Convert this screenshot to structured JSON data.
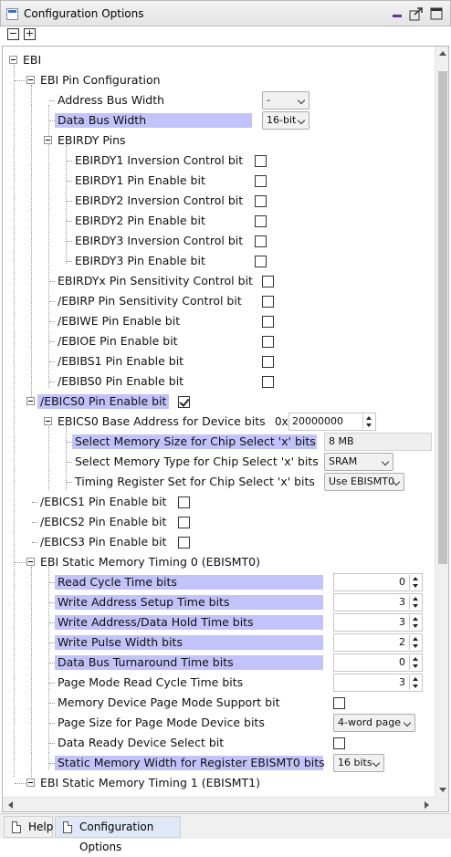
{
  "window": {
    "title": "Configuration Options",
    "icons": [
      "window-icon",
      "minimize-icon",
      "export-icon",
      "maximize-icon"
    ]
  },
  "toolbar": {
    "collapse_all": "−",
    "expand_all": "+"
  },
  "tree": {
    "ebi": "EBI",
    "pin_config": "EBI Pin Configuration",
    "address_bus_width": {
      "label": "Address Bus Width",
      "value": "-"
    },
    "data_bus_width": {
      "label": "Data Bus Width",
      "value": "16-bit"
    },
    "ebirdy_pins": "EBIRDY Pins",
    "ebirdy1_inv": {
      "label": "EBIRDY1 Inversion Control bit",
      "checked": false
    },
    "ebirdy1_en": {
      "label": "EBIRDY1 Pin Enable bit",
      "checked": false
    },
    "ebirdy2_inv": {
      "label": "EBIRDY2 Inversion Control bit",
      "checked": false
    },
    "ebirdy2_en": {
      "label": "EBIRDY2 Pin Enable bit",
      "checked": false
    },
    "ebirdy3_inv": {
      "label": "EBIRDY3 Inversion Control bit",
      "checked": false
    },
    "ebirdy3_en": {
      "label": "EBIRDY3 Pin Enable bit",
      "checked": false
    },
    "ebirdyx_sens": {
      "label": "EBIRDYx Pin Sensitivity Control bit",
      "checked": false
    },
    "ebirp_sens": {
      "label": "/EBIRP Pin Sensitivity Control bit",
      "checked": false
    },
    "ebiwe_en": {
      "label": "/EBIWE Pin Enable bit",
      "checked": false
    },
    "ebioe_en": {
      "label": "/EBIOE Pin Enable bit",
      "checked": false
    },
    "ebibs1_en": {
      "label": "/EBIBS1 Pin Enable bit",
      "checked": false
    },
    "ebibs0_en": {
      "label": "/EBIBS0 Pin Enable bit",
      "checked": false
    },
    "ebics0_en": {
      "label": "/EBICS0 Pin Enable bit",
      "checked": true
    },
    "ebics0_base": {
      "label": "EBICS0 Base Address for Device bits",
      "prefix": "0x",
      "value": "20000000"
    },
    "mem_size": {
      "label": "Select Memory Size for Chip Select 'x' bits",
      "value": "8 MB"
    },
    "mem_type": {
      "label": "Select Memory Type for Chip Select 'x' bits",
      "value": "SRAM"
    },
    "timing_reg": {
      "label": "Timing Register Set for Chip Select 'x' bits",
      "value": "Use EBISMT0"
    },
    "ebics1_en": {
      "label": "/EBICS1 Pin Enable bit",
      "checked": false
    },
    "ebics2_en": {
      "label": "/EBICS2 Pin Enable bit",
      "checked": false
    },
    "ebics3_en": {
      "label": "/EBICS3 Pin Enable bit",
      "checked": false
    },
    "smt0": "EBI Static Memory Timing 0 (EBISMT0)",
    "read_cycle": {
      "label": "Read Cycle Time bits",
      "value": "0"
    },
    "write_addr_setup": {
      "label": "Write Address Setup Time bits",
      "value": "3"
    },
    "write_addr_hold": {
      "label": "Write Address/Data Hold Time bits",
      "value": "3"
    },
    "write_pulse": {
      "label": "Write Pulse Width bits",
      "value": "2"
    },
    "data_bus_turn": {
      "label": "Data Bus Turnaround Time bits",
      "value": "0"
    },
    "page_read": {
      "label": "Page Mode Read Cycle Time bits",
      "value": "3"
    },
    "page_mode_support": {
      "label": "Memory Device Page Mode Support bit",
      "checked": false
    },
    "page_size": {
      "label": "Page Size for Page Mode Device bits",
      "value": "4-word page"
    },
    "data_ready": {
      "label": "Data Ready Device Select bit",
      "checked": false
    },
    "static_width": {
      "label": "Static Memory Width for Register EBISMT0 bits",
      "value": "16 bits"
    },
    "smt1": "EBI Static Memory Timing 1 (EBISMT1)"
  },
  "tabs": [
    {
      "label": "Help",
      "active": false
    },
    {
      "label": "Configuration Options",
      "active": true
    }
  ],
  "colors": {
    "highlight": "#c3c3fb"
  }
}
